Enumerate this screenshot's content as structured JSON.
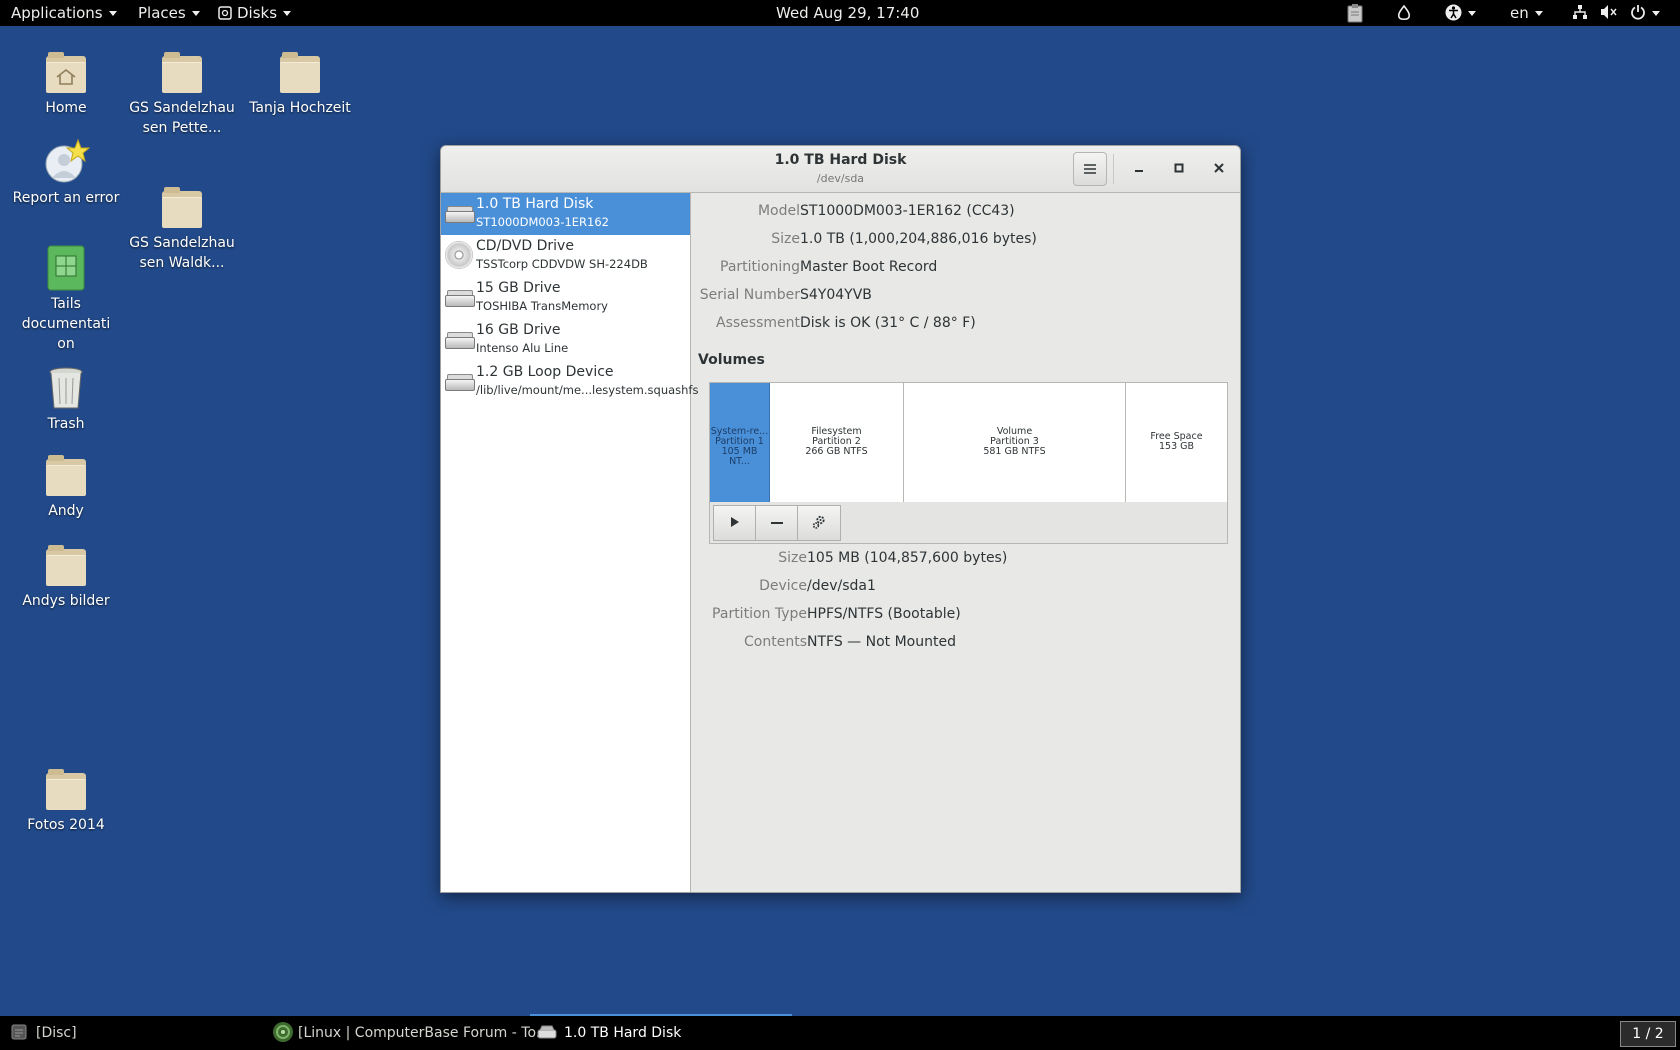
{
  "topbar": {
    "applications": "Applications",
    "places": "Places",
    "disks": "Disks",
    "clock": "Wed Aug 29, 17:40",
    "language": "en"
  },
  "desktop": {
    "icons": [
      {
        "label": "Home"
      },
      {
        "label": "GS Sandelzhau sen Pette..."
      },
      {
        "label": "Tanja Hochzeit"
      },
      {
        "label": "Report an error"
      },
      {
        "label": "GS Sandelzhau sen Waldk..."
      },
      {
        "label": "Tails documentati on"
      },
      {
        "label": "Trash"
      },
      {
        "label": "Andy"
      },
      {
        "label": "Andys bilder"
      },
      {
        "label": "Fotos 2014"
      }
    ]
  },
  "window": {
    "title": "1.0 TB Hard Disk",
    "subtitle": "/dev/sda"
  },
  "devices": [
    {
      "name": "1.0 TB Hard Disk",
      "sub": "ST1000DM003-1ER162"
    },
    {
      "name": "CD/DVD Drive",
      "sub": "TSSTcorp CDDVDW SH-224DB"
    },
    {
      "name": "15 GB Drive",
      "sub": "TOSHIBA TransMemory"
    },
    {
      "name": "16 GB Drive",
      "sub": "Intenso Alu Line"
    },
    {
      "name": "1.2 GB Loop Device",
      "sub": "/lib/live/mount/me...lesystem.squashfs"
    }
  ],
  "disk_info": {
    "model_label": "Model",
    "model": "ST1000DM003-1ER162 (CC43)",
    "size_label": "Size",
    "size": "1.0 TB (1,000,204,886,016 bytes)",
    "partitioning_label": "Partitioning",
    "partitioning": "Master Boot Record",
    "serial_label": "Serial Number",
    "serial": "S4Y04YVB",
    "assessment_label": "Assessment",
    "assessment": "Disk is OK (31° C / 88° F)"
  },
  "volumes": {
    "heading": "Volumes",
    "partitions": [
      {
        "l1": "System-re...",
        "l2": "Partition 1",
        "l3": "105 MB NT..."
      },
      {
        "l1": "Filesystem",
        "l2": "Partition 2",
        "l3": "266 GB NTFS"
      },
      {
        "l1": "Volume",
        "l2": "Partition 3",
        "l3": "581 GB NTFS"
      },
      {
        "l1": "Free Space",
        "l2": "153 GB",
        "l3": ""
      }
    ]
  },
  "volume_info": {
    "size_label": "Size",
    "size": "105 MB (104,857,600 bytes)",
    "device_label": "Device",
    "device": "/dev/sda1",
    "ptype_label": "Partition Type",
    "ptype": "HPFS/NTFS (Bootable)",
    "contents_label": "Contents",
    "contents": "NTFS — Not Mounted"
  },
  "taskbar": {
    "tasks": [
      {
        "label": "[Disc]"
      },
      {
        "label": "[Linux | ComputerBase Forum - To..."
      },
      {
        "label": "1.0 TB Hard Disk"
      }
    ],
    "workspace": "1 / 2"
  },
  "colors": {
    "accent": "#4a90d9",
    "desktop": "#224a8a"
  }
}
